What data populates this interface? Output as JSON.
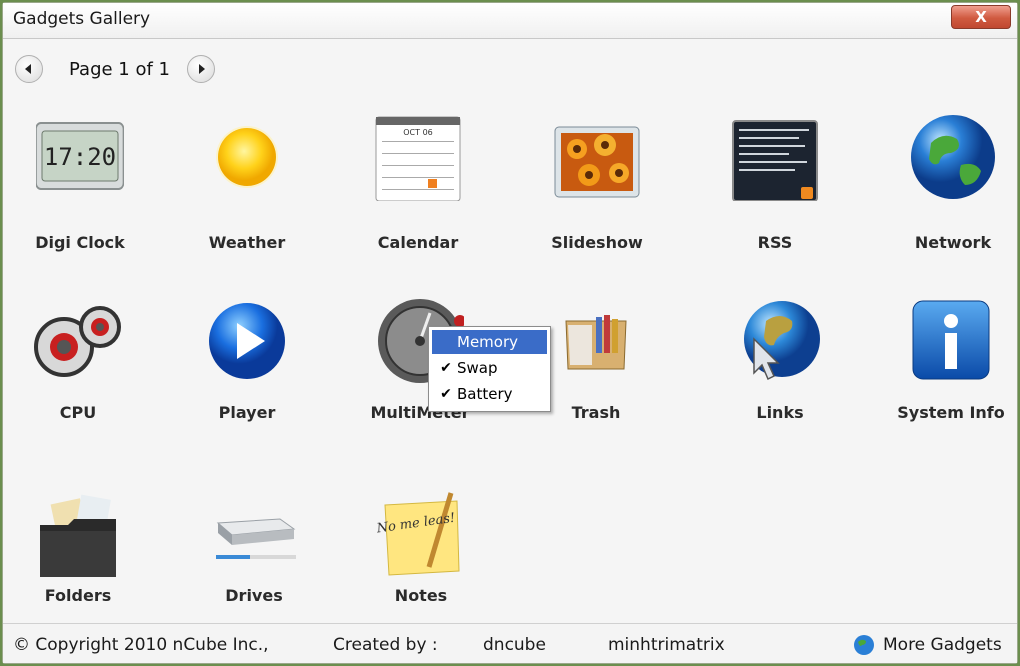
{
  "window": {
    "title": "Gadgets Gallery",
    "close_label": "X"
  },
  "pager": {
    "label": "Page 1 of 1"
  },
  "gadgets": [
    {
      "label": "Digi Clock",
      "icon": "digital-clock-icon",
      "clock_text": "17:20"
    },
    {
      "label": "Weather",
      "icon": "sun-icon"
    },
    {
      "label": "Calendar",
      "icon": "calendar-icon",
      "month": "OCT 06"
    },
    {
      "label": "Slideshow",
      "icon": "photo-frame-icon"
    },
    {
      "label": "RSS",
      "icon": "rss-feed-icon"
    },
    {
      "label": "Network",
      "icon": "globe-icon"
    },
    {
      "label": "CPU",
      "icon": "cpu-gauges-icon"
    },
    {
      "label": "Player",
      "icon": "play-icon"
    },
    {
      "label": "MultiMeter",
      "icon": "meter-dial-icon"
    },
    {
      "label": "Trash",
      "icon": "trash-box-icon"
    },
    {
      "label": "Links",
      "icon": "globe-pointer-icon"
    },
    {
      "label": "System Info",
      "icon": "info-icon"
    },
    {
      "label": "Folders",
      "icon": "folder-icon"
    },
    {
      "label": "Drives",
      "icon": "drive-icon"
    },
    {
      "label": "Notes",
      "icon": "sticky-note-icon",
      "note_text": "No me leas!"
    }
  ],
  "context_menu": {
    "items": [
      {
        "label": "Memory",
        "checked": false,
        "selected": true
      },
      {
        "label": "Swap",
        "checked": true,
        "selected": false
      },
      {
        "label": "Battery",
        "checked": true,
        "selected": false
      }
    ]
  },
  "footer": {
    "copyright": "© Copyright 2010 nCube Inc.,",
    "created_by": "Created by :",
    "author1": "dncube",
    "author2": "minhtrimatrix",
    "more_gadgets": "More Gadgets"
  },
  "colors": {
    "menu_highlight": "#3a6cc8",
    "close_button": "#d05a40",
    "frame": "#6b8e4e"
  }
}
